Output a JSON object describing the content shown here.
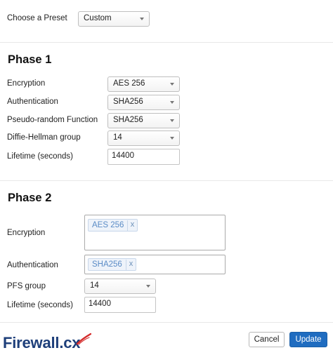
{
  "preset": {
    "label": "Choose a Preset",
    "value": "Custom"
  },
  "phase1": {
    "title": "Phase 1",
    "encryption": {
      "label": "Encryption",
      "value": "AES 256"
    },
    "authentication": {
      "label": "Authentication",
      "value": "SHA256"
    },
    "prf": {
      "label": "Pseudo-random Function",
      "value": "SHA256"
    },
    "dh_group": {
      "label": "Diffie-Hellman group",
      "value": "14"
    },
    "lifetime": {
      "label": "Lifetime (seconds)",
      "value": "14400"
    }
  },
  "phase2": {
    "title": "Phase 2",
    "encryption": {
      "label": "Encryption",
      "tag": "AES 256",
      "remove": "x"
    },
    "authentication": {
      "label": "Authentication",
      "tag": "SHA256",
      "remove": "x"
    },
    "pfs_group": {
      "label": "PFS group",
      "value": "14"
    },
    "lifetime": {
      "label": "Lifetime (seconds)",
      "value": "14400"
    }
  },
  "footer": {
    "logo_text": "Firewall.cx",
    "cancel_label": "Cancel",
    "update_label": "Update"
  },
  "colors": {
    "primary_button": "#1f6cc0",
    "tag_background": "#eef3fa",
    "tag_text": "#5b8cc6",
    "logo": "#1e3f7a",
    "logo_accent": "#d42b2b"
  }
}
